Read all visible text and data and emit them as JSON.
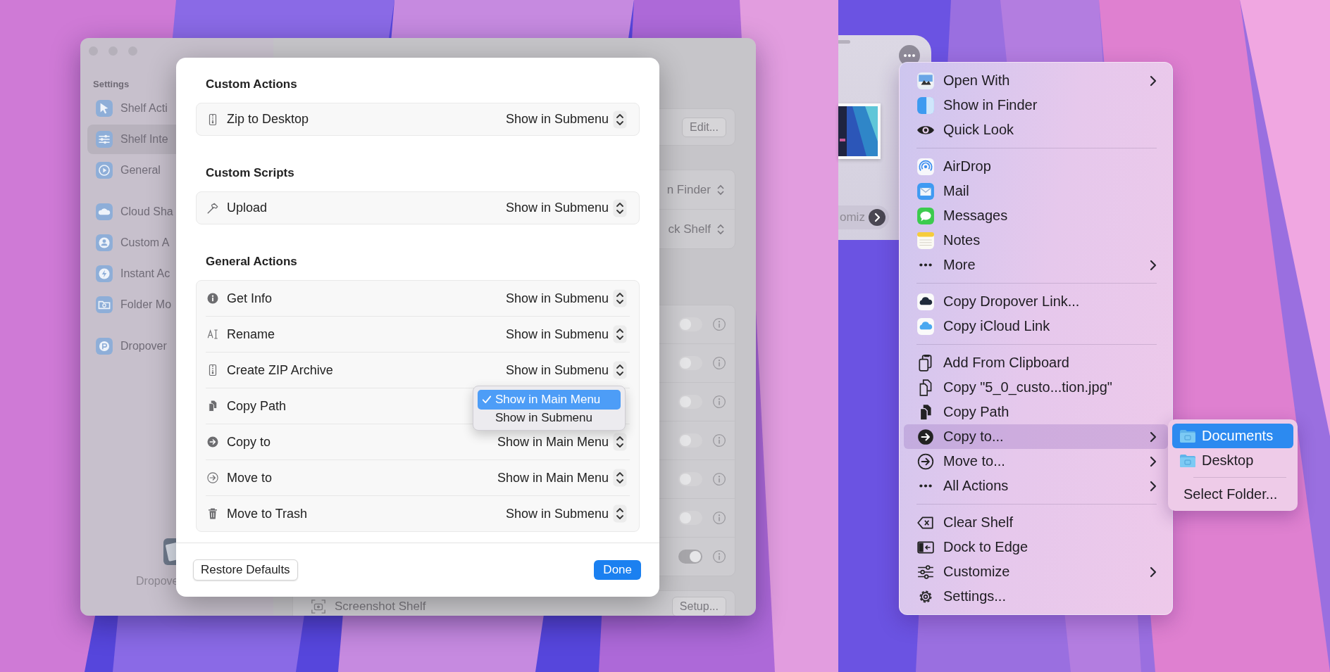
{
  "settings_window": {
    "sidebar": {
      "heading": "Settings",
      "groups": [
        [
          {
            "label": "Shelf Acti",
            "selected": false
          },
          {
            "label": "Shelf Inte",
            "selected": true
          },
          {
            "label": "General",
            "selected": false
          }
        ],
        [
          {
            "label": "Cloud Sha",
            "selected": false
          },
          {
            "label": "Custom A",
            "selected": false
          },
          {
            "label": "Instant Ac",
            "selected": false
          },
          {
            "label": "Folder Mo",
            "selected": false
          }
        ],
        [
          {
            "label": "Dropover",
            "selected": false
          }
        ]
      ],
      "footer_label": "Dropove"
    },
    "content": {
      "edit_button": "Edit...",
      "popups": [
        "n Finder",
        "ck Shelf"
      ],
      "toggles": [
        {
          "on": false
        },
        {
          "on": false
        },
        {
          "on": false
        },
        {
          "on": false
        },
        {
          "on": false
        },
        {
          "on": false
        },
        {
          "on": true
        }
      ],
      "screenshot_row": {
        "label": "Screenshot Shelf",
        "button": "Setup..."
      }
    }
  },
  "sheet": {
    "sections": [
      {
        "title": "Custom Actions",
        "rows": [
          {
            "label": "Zip to Desktop",
            "value": "Show in Submenu"
          }
        ]
      },
      {
        "title": "Custom Scripts",
        "rows": [
          {
            "label": "Upload",
            "value": "Show in Submenu"
          }
        ]
      },
      {
        "title": "General Actions",
        "rows": [
          {
            "label": "Get Info",
            "value": "Show in Submenu"
          },
          {
            "label": "Rename",
            "value": "Show in Submenu"
          },
          {
            "label": "Create ZIP Archive",
            "value": "Show in Submenu"
          },
          {
            "label": "Copy Path"
          },
          {
            "label": "Copy to",
            "value": "Show in Main Menu"
          },
          {
            "label": "Move to",
            "value": "Show in Main Menu"
          },
          {
            "label": "Move to Trash",
            "value": "Show in Submenu"
          }
        ]
      }
    ],
    "popup_menu": {
      "options": [
        {
          "label": "Show in Main Menu",
          "selected": true
        },
        {
          "label": "Show in Submenu",
          "selected": false
        }
      ]
    },
    "restore_button": "Restore Defaults",
    "done_button": "Done"
  },
  "shelf": {
    "chip_label": "omiz"
  },
  "context_menu": {
    "groups": [
      [
        {
          "label": "Open With",
          "submenu": true,
          "selected": false
        },
        {
          "label": "Show in Finder",
          "submenu": false,
          "selected": false
        },
        {
          "label": "Quick Look",
          "submenu": false,
          "selected": false
        }
      ],
      [
        {
          "label": "AirDrop",
          "submenu": false,
          "selected": false
        },
        {
          "label": "Mail",
          "submenu": false,
          "selected": false
        },
        {
          "label": "Messages",
          "submenu": false,
          "selected": false
        },
        {
          "label": "Notes",
          "submenu": false,
          "selected": false
        },
        {
          "label": "More",
          "submenu": true,
          "selected": false
        }
      ],
      [
        {
          "label": "Copy Dropover Link...",
          "submenu": false,
          "selected": false
        },
        {
          "label": "Copy iCloud Link",
          "submenu": false,
          "selected": false
        }
      ],
      [
        {
          "label": "Add From Clipboard",
          "submenu": false,
          "selected": false
        },
        {
          "label": "Copy \"5_0_custo...tion.jpg\"",
          "submenu": false,
          "selected": false
        },
        {
          "label": "Copy Path",
          "submenu": false,
          "selected": false
        },
        {
          "label": "Copy to...",
          "submenu": true,
          "selected": true
        },
        {
          "label": "Move to...",
          "submenu": true,
          "selected": false
        },
        {
          "label": "All Actions",
          "submenu": true,
          "selected": false
        }
      ],
      [
        {
          "label": "Clear Shelf",
          "submenu": false,
          "selected": false
        },
        {
          "label": "Dock to Edge",
          "submenu": false,
          "selected": false
        },
        {
          "label": "Customize",
          "submenu": true,
          "selected": false
        },
        {
          "label": "Settings...",
          "submenu": false,
          "selected": false
        }
      ]
    ]
  },
  "submenu": {
    "items": [
      {
        "label": "Documents",
        "selected": true
      },
      {
        "label": "Desktop",
        "selected": false
      }
    ],
    "action": "Select Folder..."
  }
}
